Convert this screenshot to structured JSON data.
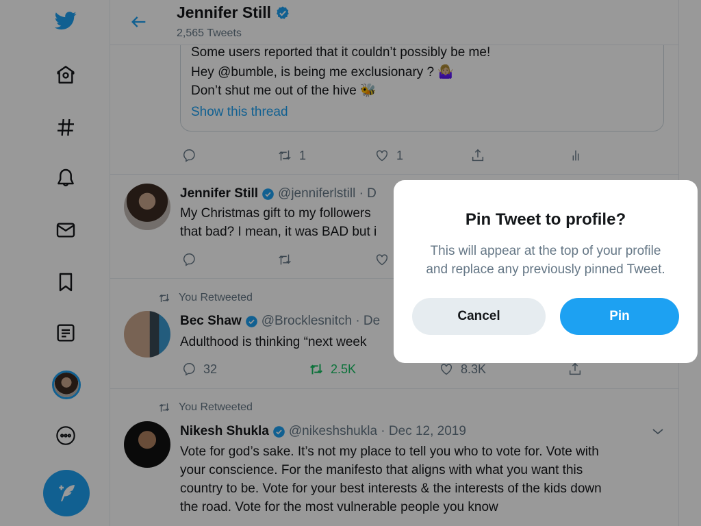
{
  "colors": {
    "accent": "#1da1f2",
    "retweet_active": "#17bf63",
    "text_primary": "#14171a",
    "text_secondary": "#657786",
    "border": "#e6ecf0"
  },
  "sidebar": {
    "items": [
      {
        "name": "twitter-logo",
        "icon": "bird"
      },
      {
        "name": "home",
        "icon": "home"
      },
      {
        "name": "explore",
        "icon": "hashtag"
      },
      {
        "name": "notifications",
        "icon": "bell"
      },
      {
        "name": "messages",
        "icon": "envelope"
      },
      {
        "name": "bookmarks",
        "icon": "bookmark"
      },
      {
        "name": "lists",
        "icon": "list"
      },
      {
        "name": "profile",
        "icon": "avatar"
      },
      {
        "name": "more",
        "icon": "more-circle"
      },
      {
        "name": "compose-tweet",
        "icon": "feather-plus"
      }
    ]
  },
  "header": {
    "title": "Jennifer Still",
    "subtitle": "2,565 Tweets"
  },
  "quoted": {
    "lines": [
      "Some users reported that it couldn’t possibly be me!",
      "Hey @bumble, is being me exclusionary ? 🤷🏼‍♀️",
      "Don’t shut me out of the hive 🐝"
    ],
    "link": "Show this thread"
  },
  "tweets": [
    {
      "actions": {
        "reply": "",
        "retweet": "1",
        "like": "1"
      }
    },
    {
      "name": "Jennifer Still",
      "handle": "@jenniferlstill · D",
      "text": [
        "My Christmas gift to my followers",
        "that bad? I mean, it was BAD but i"
      ],
      "actions": {
        "reply": "",
        "retweet": "",
        "like": ""
      }
    },
    {
      "retweet_label": "You Retweeted",
      "name": "Bec Shaw",
      "handle": "@Brocklesnitch · De",
      "text": [
        "Adulthood is thinking “next week"
      ],
      "actions": {
        "reply": "32",
        "retweet": "2.5K",
        "like": "8.3K"
      }
    },
    {
      "retweet_label": "You Retweeted",
      "name": "Nikesh Shukla",
      "handle": "@nikeshshukla · Dec 12, 2019",
      "text": [
        "Vote for god’s sake. It’s not my place to tell you who to vote for. Vote with",
        "your conscience. For the manifesto that aligns with what you want this",
        "country to be. Vote for your best interests & the interests of the kids down",
        "the road. Vote for the most vulnerable people you know"
      ]
    }
  ],
  "modal": {
    "title": "Pin Tweet to profile?",
    "body_line1": "This will appear at the top of your profile",
    "body_line2": "and replace any previously pinned Tweet.",
    "cancel_label": "Cancel",
    "confirm_label": "Pin"
  }
}
